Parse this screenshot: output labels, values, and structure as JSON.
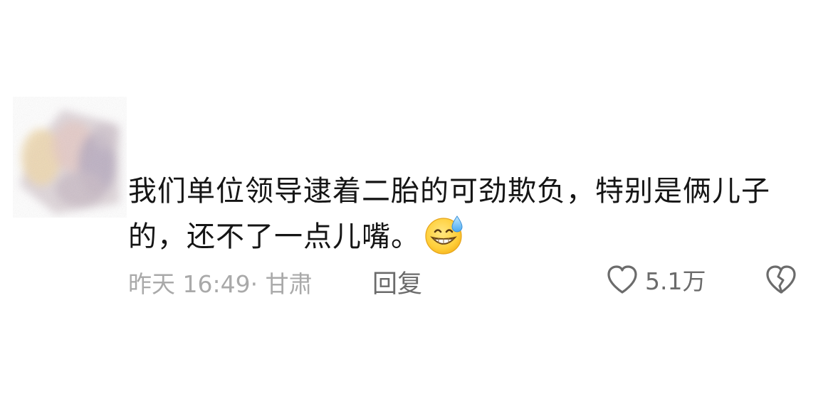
{
  "comment": {
    "text": "我们单位领导逮着二胎的可劲欺负，特别是俩儿子的，还不了一点儿嘴。",
    "emoji": "sweat-grin-emoji"
  },
  "meta": {
    "time_location": "昨天 16:49· 甘肃",
    "reply_label": "回复",
    "like_count": "5.1万"
  },
  "icons": {
    "like": "heart-outline-icon",
    "dislike": "broken-heart-outline-icon"
  },
  "colors": {
    "text": "#151515",
    "meta": "#a9a9a9",
    "action": "#6b6b6b"
  }
}
